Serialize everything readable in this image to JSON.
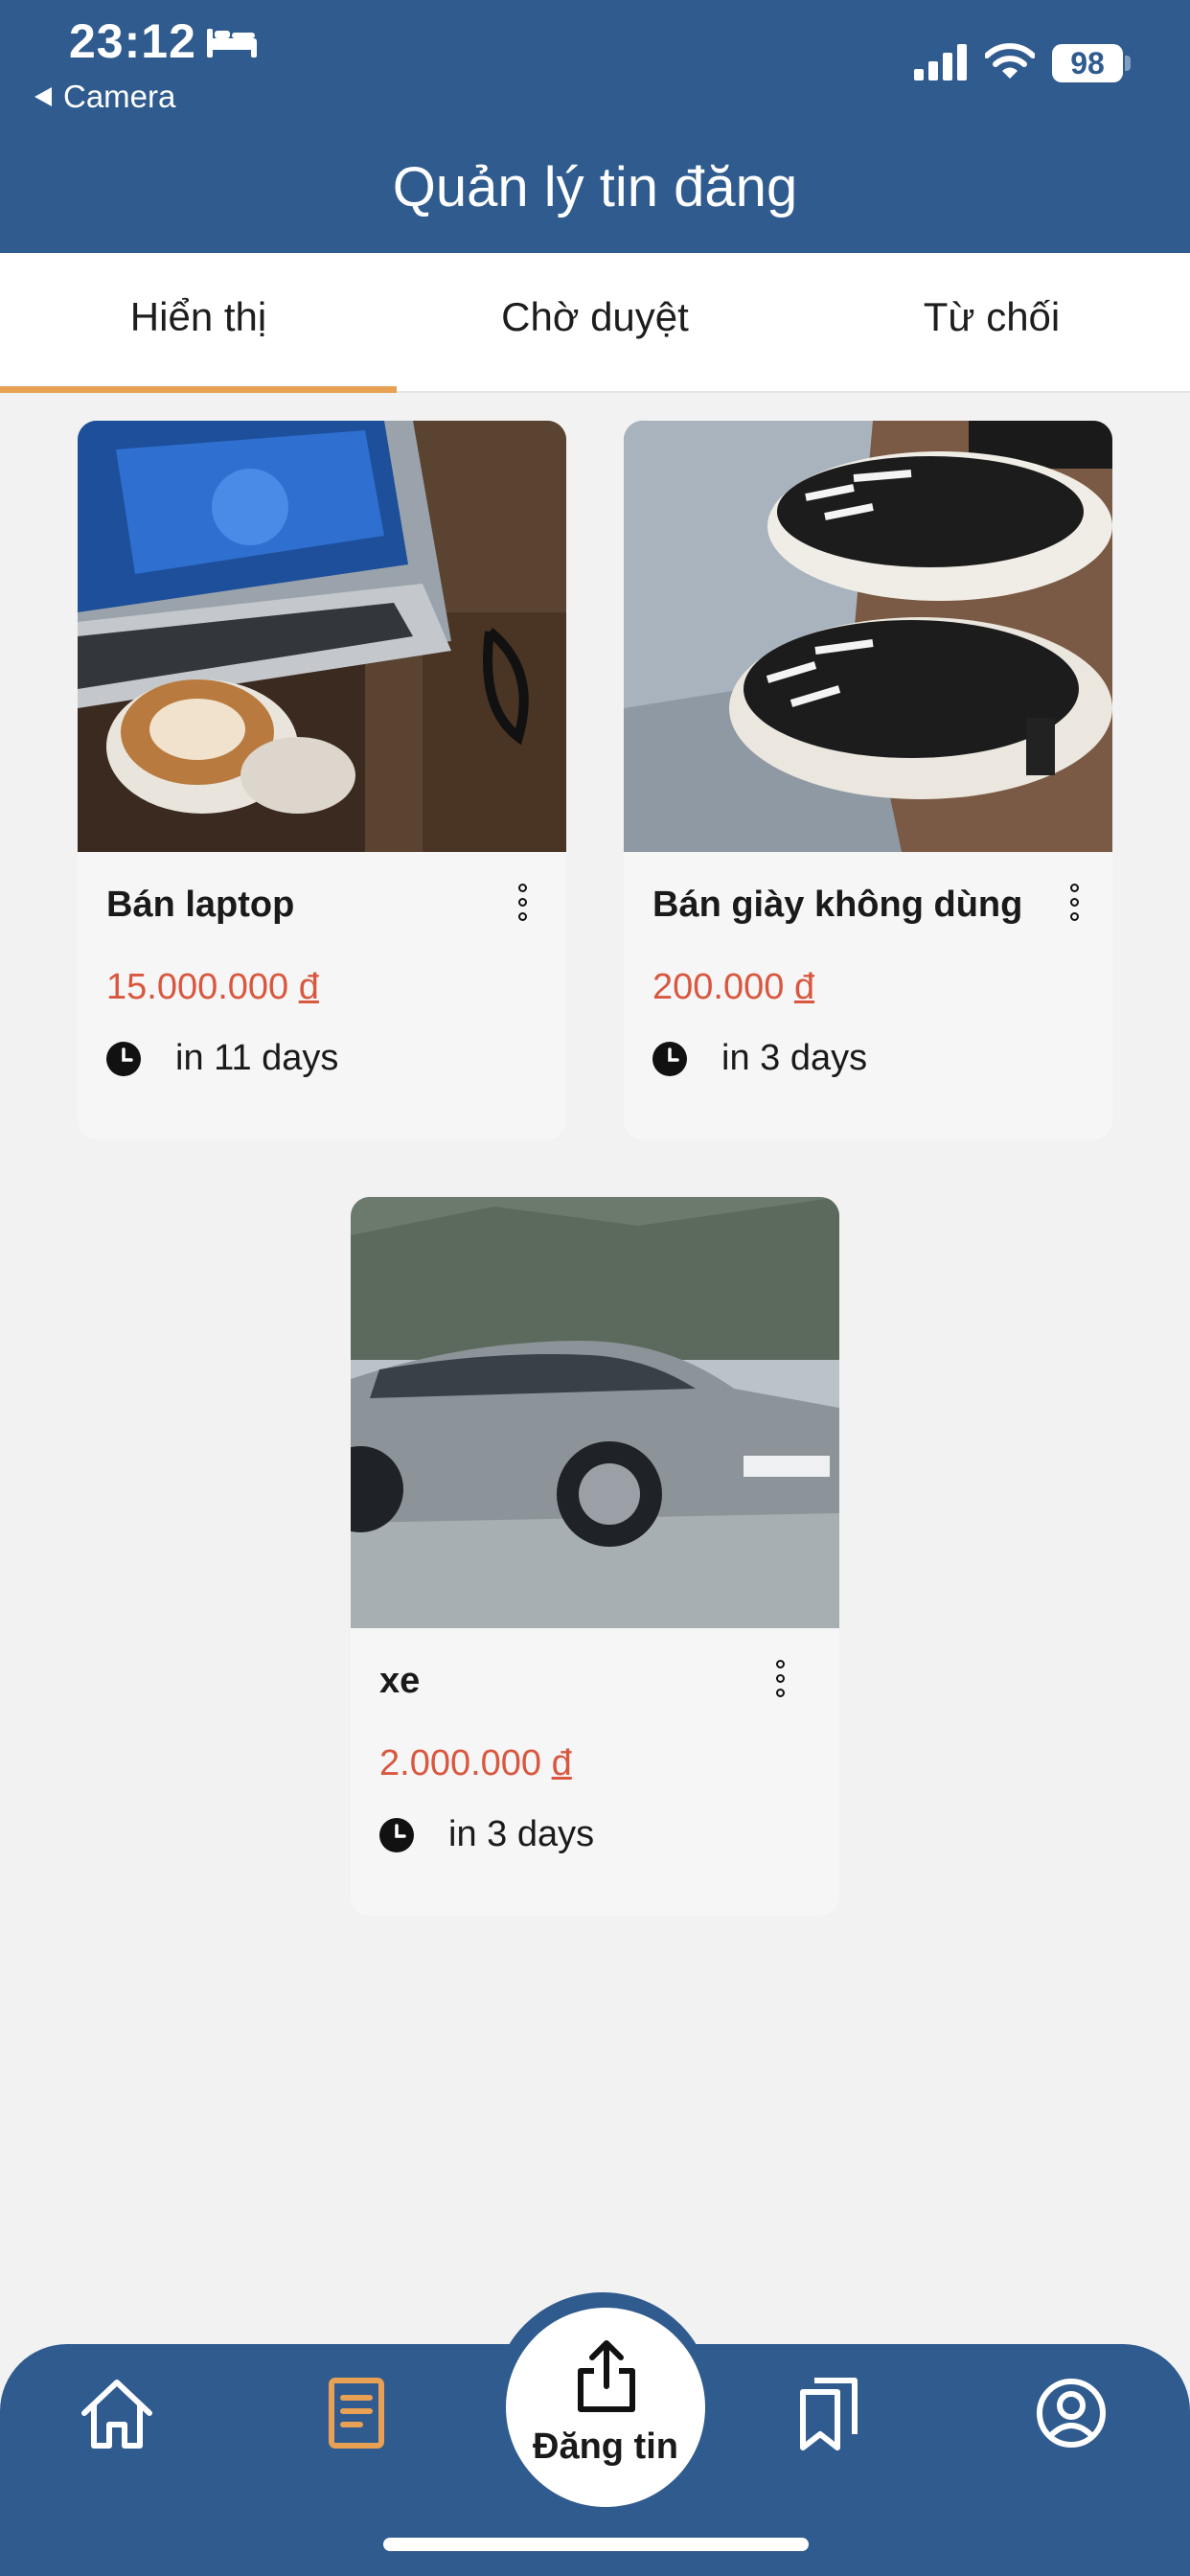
{
  "status_bar": {
    "time": "23:12",
    "back_label": "Camera",
    "battery": "98"
  },
  "header": {
    "title": "Quản lý tin đăng"
  },
  "tabs": [
    {
      "label": "Hiển thị",
      "active": true
    },
    {
      "label": "Chờ duyệt",
      "active": false
    },
    {
      "label": "Từ chối",
      "active": false
    }
  ],
  "listings": [
    {
      "title": "Bán laptop",
      "price": "15.000.000",
      "currency": "đ",
      "expires": "in 11 days",
      "image": "laptop-coffee-photo"
    },
    {
      "title": "Bán giày không dùng",
      "price": "200.000",
      "currency": "đ",
      "expires": "in 3 days",
      "image": "sneakers-photo"
    },
    {
      "title": "xe",
      "price": "2.000.000",
      "currency": "đ",
      "expires": "in 3 days",
      "image": "car-photo"
    }
  ],
  "bottom_nav": {
    "items": [
      "home-icon",
      "document-icon",
      "upload-icon",
      "bookmarks-icon",
      "profile-icon"
    ],
    "post_label": "Đăng tin",
    "active_item": "document-icon"
  },
  "colors": {
    "primary": "#2f5b8f",
    "accent": "#e8a154",
    "price": "#d9573f",
    "background": "#f2f2f2"
  }
}
